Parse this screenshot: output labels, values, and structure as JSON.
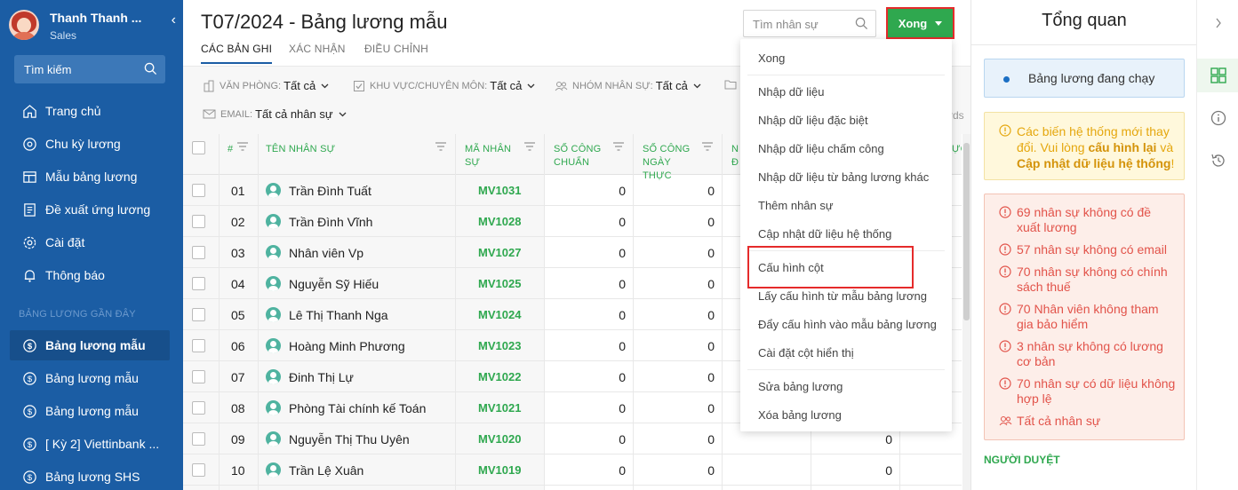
{
  "sidebar": {
    "user_name": "Thanh Thanh ...",
    "user_role": "Sales",
    "collapse_icon": "‹",
    "search_label": "Tìm kiếm",
    "nav": [
      {
        "label": "Trang chủ",
        "icon": "home-icon"
      },
      {
        "label": "Chu kỳ lương",
        "icon": "cycle-icon"
      },
      {
        "label": "Mẫu bảng lương",
        "icon": "table-icon"
      },
      {
        "label": "Đề xuất ứng lương",
        "icon": "document-icon"
      },
      {
        "label": "Cài đặt",
        "icon": "gear-icon"
      },
      {
        "label": "Thông báo",
        "icon": "bell-icon"
      }
    ],
    "recent_title": "BẢNG LƯƠNG GẦN ĐÂY",
    "recent": [
      {
        "label": "Bảng lương mẫu",
        "active": true
      },
      {
        "label": "Bảng lương mẫu",
        "active": false
      },
      {
        "label": "Bảng lương mẫu",
        "active": false
      },
      {
        "label": "[ Kỳ 2] Viettinbank ...",
        "active": false
      },
      {
        "label": "Bảng lương SHS",
        "active": false
      }
    ]
  },
  "header": {
    "title": "T07/2024 - Bảng lương mẫu",
    "tabs": [
      "CÁC BẢN GHI",
      "XÁC NHẬN",
      "ĐIỀU CHỈNH"
    ],
    "search_placeholder": "Tìm nhân sự",
    "done_label": "Xong"
  },
  "filters": [
    {
      "label": "VĂN PHÒNG:",
      "value": "Tất cả",
      "icon": "building-icon"
    },
    {
      "label": "KHU VỰC/CHUYÊN MÔN:",
      "value": "Tất cả",
      "icon": "checkbox-icon"
    },
    {
      "label": "NHÓM NHÂN SỰ:",
      "value": "Tất cả",
      "icon": "people-icon"
    },
    {
      "label": "EMAIL:",
      "value": "Tất cả nhân sự",
      "icon": "mail-icon"
    }
  ],
  "records_label": "rds",
  "table": {
    "columns": [
      "#",
      "TÊN NHÂN SỰ",
      "MÃ NHÂN SỰ",
      "SỐ CÔNG CHUẨN",
      "SỐ CÔNG NGÀY THỰC",
      "N",
      "ỰC"
    ],
    "col_mid_partial": "Đ",
    "rows": [
      {
        "num": "01",
        "name": "Trần Đình Tuất",
        "code": "MV1031",
        "std": "0",
        "actual": "0",
        "extra": ""
      },
      {
        "num": "02",
        "name": "Trần Đình Vĩnh",
        "code": "MV1028",
        "std": "0",
        "actual": "0",
        "extra": ""
      },
      {
        "num": "03",
        "name": "Nhân viên Vp",
        "code": "MV1027",
        "std": "0",
        "actual": "0",
        "extra": ""
      },
      {
        "num": "04",
        "name": "Nguyễn Sỹ Hiếu",
        "code": "MV1025",
        "std": "0",
        "actual": "0",
        "extra": ""
      },
      {
        "num": "05",
        "name": "Lê Thị Thanh Nga",
        "code": "MV1024",
        "std": "0",
        "actual": "0",
        "extra": ""
      },
      {
        "num": "06",
        "name": "Hoàng Minh Phương",
        "code": "MV1023",
        "std": "0",
        "actual": "0",
        "extra": ""
      },
      {
        "num": "07",
        "name": "Đinh Thị Lự",
        "code": "MV1022",
        "std": "0",
        "actual": "0",
        "extra": ""
      },
      {
        "num": "08",
        "name": "Phòng Tài chính kế Toán",
        "code": "MV1021",
        "std": "0",
        "actual": "0",
        "extra": ""
      },
      {
        "num": "09",
        "name": "Nguyễn Thị Thu Uyên",
        "code": "MV1020",
        "std": "0",
        "actual": "0",
        "extra": "0"
      },
      {
        "num": "10",
        "name": "Trần Lệ Xuân",
        "code": "MV1019",
        "std": "0",
        "actual": "0",
        "extra": "0"
      }
    ]
  },
  "dropdown": {
    "items": [
      "Xong",
      "Nhập dữ liệu",
      "Nhập dữ liệu đặc biệt",
      "Nhập dữ liệu chấm công",
      "Nhập dữ liệu từ bảng lương khác",
      "Thêm nhân sự",
      "Cập nhật dữ liệu hệ thống",
      "Cấu hình cột",
      "Lấy cấu hình từ mẫu bảng lương",
      "Đẩy cấu hình vào mẫu bảng lương",
      "Cài đặt cột hiển thị",
      "Sửa bảng lương",
      "Xóa bảng lương"
    ],
    "highlighted": "Cấu hình cột"
  },
  "overview": {
    "title": "Tổng quan",
    "running": "Bảng lương đang chạy",
    "warning_pre": "Các biến hệ thống mới thay đổi. Vui lòng ",
    "warning_b1": "cấu hình lại",
    "warning_mid": " và ",
    "warning_b2": "Cập nhật dữ liệu hệ thống",
    "warning_post": "!",
    "errors": [
      "69 nhân sự không có đề xuất lương",
      "57 nhân sự không có email",
      "70 nhân sự không có chính sách thuế",
      "70 Nhân viên không tham gia bảo hiểm",
      "3 nhân sự không có lương cơ bản",
      "70 nhân sự có dữ liệu không hợp lệ"
    ],
    "all_staff": "Tất cả nhân sự",
    "approver_title": "NGƯỜI DUYỆT"
  },
  "colors": {
    "sidebar": "#1b5da4",
    "accent_green": "#2fa84f",
    "highlight_red": "#e52b2b",
    "warn": "#e5a70e",
    "error": "#e2534a"
  }
}
